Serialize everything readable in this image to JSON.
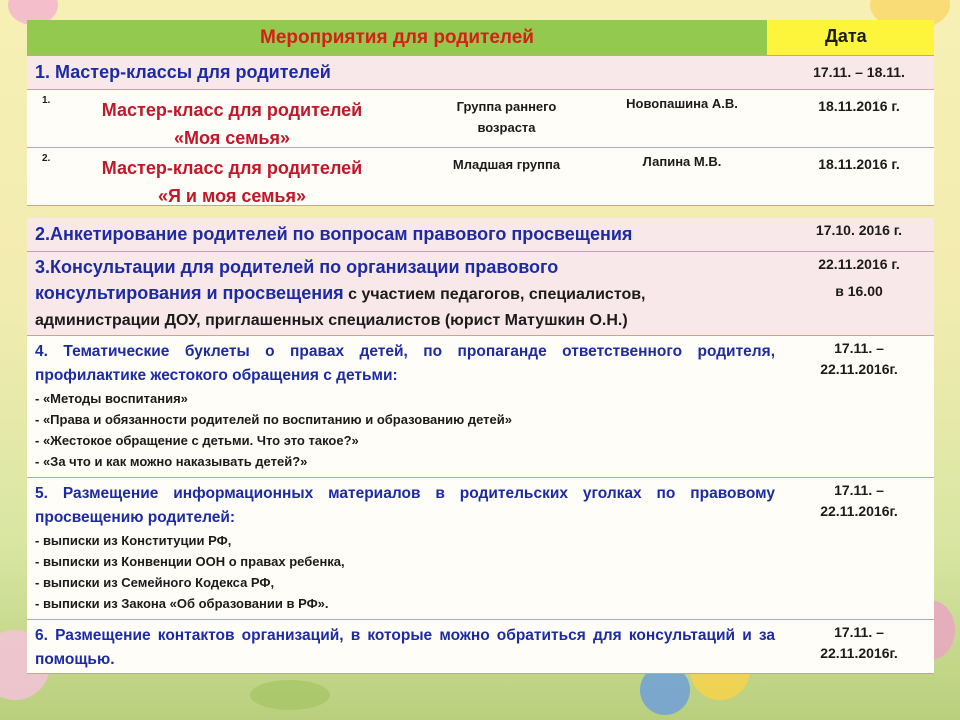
{
  "header": {
    "activities_label": "Мероприятия для родителей",
    "date_label": "Дата"
  },
  "section1": {
    "title": "1. Мастер-классы для родителей",
    "date": "17.11. – 18.11.",
    "rows": [
      {
        "num": "1.",
        "name_line1": "Мастер-класс для родителей",
        "name_line2": "«Моя семья»",
        "group_line1": "Группа раннего",
        "group_line2": "возраста",
        "person": "Новопашина А.В.",
        "date": "18.11.2016 г."
      },
      {
        "num": "2.",
        "name_line1": "Мастер-класс для родителей",
        "name_line2": "«Я и моя семья»",
        "group_line1": "Младшая группа",
        "group_line2": "",
        "person": "Лапина М.В.",
        "date": "18.11.2016 г."
      }
    ]
  },
  "section2": {
    "title": "2.Анкетирование родителей по вопросам правового просвещения",
    "date": "17.10. 2016 г."
  },
  "section3": {
    "title_line1": "3.Консультации для родителей по организации правового",
    "title_line2": "консультирования и просвещения",
    "title_line2_rest": " с участием педагогов, специалистов,",
    "title_line3": "администрации ДОУ, приглашенных специалистов (юрист Матушкин О.Н.)",
    "date_line1": "22.11.2016 г.",
    "date_line2": "в 16.00"
  },
  "section4": {
    "title": "4. Тематические буклеты о правах детей, по пропаганде ответственного родителя, профилактике жестокого обращения с детьми:",
    "date_line1": "17.11. –",
    "date_line2": "22.11.2016г.",
    "items": [
      "- «Методы воспитания»",
      "- «Права и обязанности родителей по воспитанию и образованию детей»",
      "- «Жестокое обращение с детьми. Что это такое?»",
      "- «За что и как можно наказывать детей?»"
    ]
  },
  "section5": {
    "title": "5. Размещение информационных материалов в родительских уголках по правовому просвещению родителей:",
    "date_line1": "17.11. –",
    "date_line2": "22.11.2016г.",
    "items": [
      "- выписки из Конституции РФ,",
      "- выписки из Конвенции ООН о правах ребенка,",
      "- выписки из Семейного Кодекса РФ,",
      "- выписки из Закона «Об образовании в РФ»."
    ]
  },
  "section6": {
    "title": "6. Размещение контактов организаций, в которые можно обратиться для консультаций и за помощью.",
    "date_line1": "17.11. –",
    "date_line2": "22.11.2016г."
  },
  "colors": {
    "header_green": "#93c94e",
    "header_yellow": "#fdf53b",
    "title_red": "#d61f17",
    "item_red": "#c0182a",
    "heading_blue": "#1d2ba3",
    "row_pink": "#f9e8ea"
  }
}
